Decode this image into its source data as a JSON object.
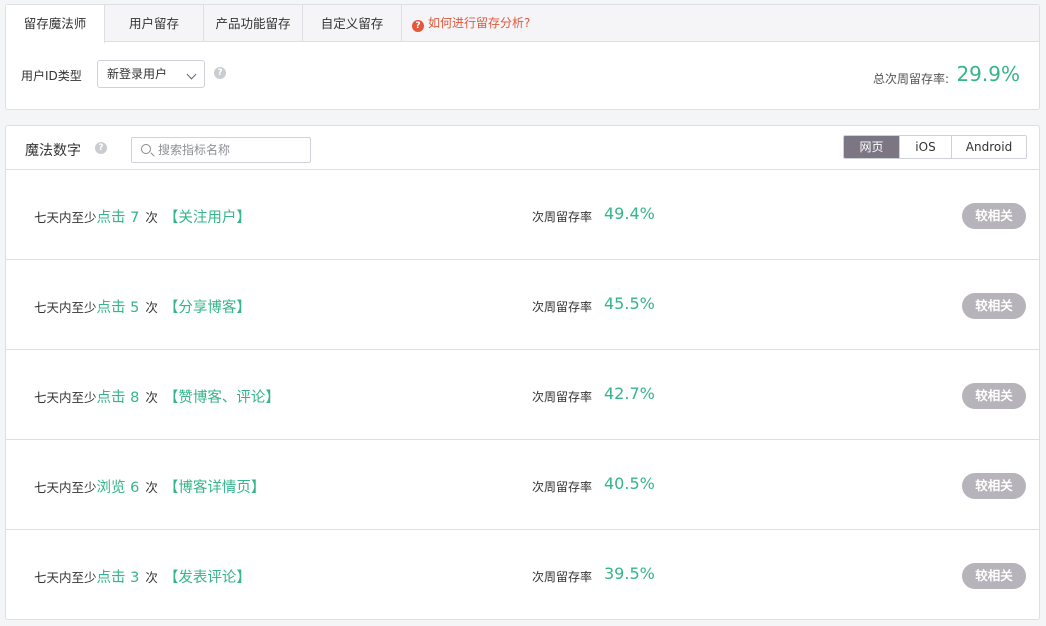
{
  "tabs": [
    {
      "label": "留存魔法师",
      "active": true
    },
    {
      "label": "用户留存",
      "active": false
    },
    {
      "label": "产品功能留存",
      "active": false
    },
    {
      "label": "自定义留存",
      "active": false
    }
  ],
  "help_link": {
    "icon": "question-circle-icon",
    "label": "如何进行留存分析?"
  },
  "user_id": {
    "label": "用户ID类型",
    "selected": "新登录用户"
  },
  "total": {
    "label": "总次周留存率:",
    "value": "29.9%"
  },
  "magic": {
    "title": "魔法数字",
    "search_placeholder": "搜索指标名称",
    "platforms": [
      {
        "label": "网页",
        "active": true
      },
      {
        "label": "iOS",
        "active": false
      },
      {
        "label": "Android",
        "active": false
      }
    ],
    "rows": [
      {
        "prefix": "七天内至少",
        "action": "点击 7",
        "suffix": "次",
        "event": "【关注用户】",
        "rate_label": "次周留存率",
        "rate": "49.4%",
        "badge": "较相关"
      },
      {
        "prefix": "七天内至少",
        "action": "点击 5",
        "suffix": "次",
        "event": "【分享博客】",
        "rate_label": "次周留存率",
        "rate": "45.5%",
        "badge": "较相关"
      },
      {
        "prefix": "七天内至少",
        "action": "点击 8",
        "suffix": "次",
        "event": "【赞博客、评论】",
        "rate_label": "次周留存率",
        "rate": "42.7%",
        "badge": "较相关"
      },
      {
        "prefix": "七天内至少",
        "action": "浏览 6",
        "suffix": "次",
        "event": "【博客详情页】",
        "rate_label": "次周留存率",
        "rate": "40.5%",
        "badge": "较相关"
      },
      {
        "prefix": "七天内至少",
        "action": "点击 3",
        "suffix": "次",
        "event": "【发表评论】",
        "rate_label": "次周留存率",
        "rate": "39.5%",
        "badge": "较相关"
      }
    ]
  },
  "colors": {
    "accent": "#34b58b",
    "warning": "#e2583c",
    "active_segment": "#7b7584",
    "badge": "#b6b3ba"
  }
}
